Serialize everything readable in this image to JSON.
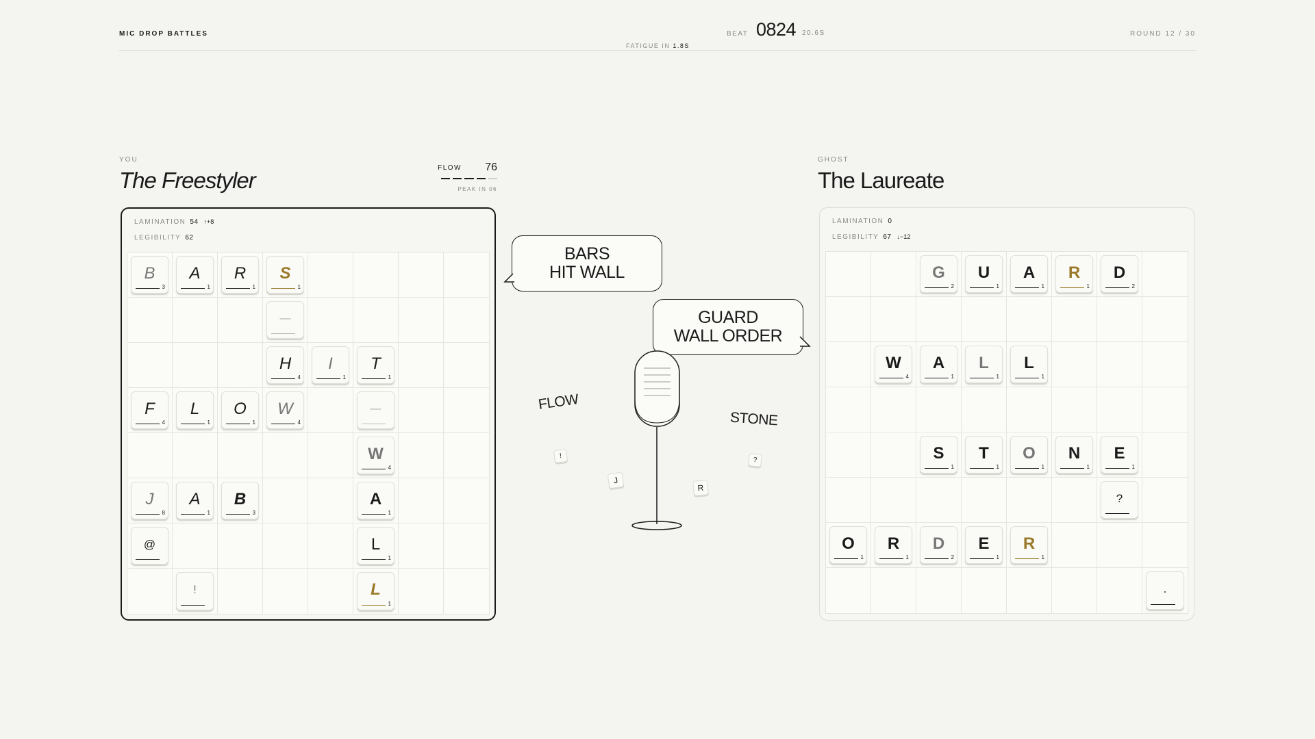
{
  "header": {
    "brand": "MIC DROP BATTLES",
    "beat_label": "BEAT",
    "beat_number": "0824",
    "beat_time": "20.6S",
    "fatigue_label": "FATIGUE IN",
    "fatigue_value": "1.8S",
    "round": "ROUND 12 / 30"
  },
  "player": {
    "side_label": "YOU",
    "name": "The Freestyler",
    "flow_label": "FLOW",
    "flow_value": "76",
    "flow_level": 0.8,
    "peak_label": "PEAK IN 06",
    "lamination_label": "LAMINATION",
    "lamination_value": "54",
    "lamination_delta": "↑+8",
    "legibility_label": "LEGIBILITY",
    "legibility_value": "62",
    "tiles": [
      {
        "r": 0,
        "c": 0,
        "ch": "B",
        "pt": "3",
        "s": "it gray"
      },
      {
        "r": 0,
        "c": 1,
        "ch": "A",
        "pt": "1",
        "s": "it"
      },
      {
        "r": 0,
        "c": 2,
        "ch": "R",
        "pt": "1",
        "s": "it"
      },
      {
        "r": 0,
        "c": 3,
        "ch": "S",
        "pt": "1",
        "s": "it gold bd"
      },
      {
        "r": 1,
        "c": 3,
        "ch": "—",
        "pt": "",
        "s": "dim"
      },
      {
        "r": 2,
        "c": 3,
        "ch": "H",
        "pt": "4",
        "s": "it"
      },
      {
        "r": 2,
        "c": 4,
        "ch": "I",
        "pt": "1",
        "s": "it gray"
      },
      {
        "r": 2,
        "c": 5,
        "ch": "T",
        "pt": "1",
        "s": "it"
      },
      {
        "r": 3,
        "c": 0,
        "ch": "F",
        "pt": "4",
        "s": "it"
      },
      {
        "r": 3,
        "c": 1,
        "ch": "L",
        "pt": "1",
        "s": "it"
      },
      {
        "r": 3,
        "c": 2,
        "ch": "O",
        "pt": "1",
        "s": "it"
      },
      {
        "r": 3,
        "c": 3,
        "ch": "W",
        "pt": "4",
        "s": "it gray"
      },
      {
        "r": 3,
        "c": 5,
        "ch": "—",
        "pt": "",
        "s": "dim"
      },
      {
        "r": 4,
        "c": 5,
        "ch": "W",
        "pt": "4",
        "s": "bd gray"
      },
      {
        "r": 5,
        "c": 0,
        "ch": "J",
        "pt": "8",
        "s": "it gray"
      },
      {
        "r": 5,
        "c": 1,
        "ch": "A",
        "pt": "1",
        "s": "it"
      },
      {
        "r": 5,
        "c": 2,
        "ch": "B",
        "pt": "3",
        "s": "it bd"
      },
      {
        "r": 5,
        "c": 5,
        "ch": "A",
        "pt": "1",
        "s": "bd"
      },
      {
        "r": 6,
        "c": 0,
        "ch": "@",
        "pt": "",
        "s": "sm"
      },
      {
        "r": 6,
        "c": 5,
        "ch": "L",
        "pt": "1",
        "s": ""
      },
      {
        "r": 7,
        "c": 1,
        "ch": "!",
        "pt": "",
        "s": "sm gray"
      },
      {
        "r": 7,
        "c": 5,
        "ch": "L",
        "pt": "1",
        "s": "it gold bd"
      }
    ]
  },
  "ghost": {
    "side_label": "GHOST",
    "name": "The Laureate",
    "lamination_label": "LAMINATION",
    "lamination_value": "0",
    "legibility_label": "LEGIBILITY",
    "legibility_value": "67",
    "legibility_delta": "↓−12",
    "tiles": [
      {
        "r": 0,
        "c": 2,
        "ch": "G",
        "pt": "2",
        "s": "bd gray"
      },
      {
        "r": 0,
        "c": 3,
        "ch": "U",
        "pt": "1",
        "s": "bd"
      },
      {
        "r": 0,
        "c": 4,
        "ch": "A",
        "pt": "1",
        "s": "bd"
      },
      {
        "r": 0,
        "c": 5,
        "ch": "R",
        "pt": "1",
        "s": "bd gold"
      },
      {
        "r": 0,
        "c": 6,
        "ch": "D",
        "pt": "2",
        "s": "bd"
      },
      {
        "r": 2,
        "c": 1,
        "ch": "W",
        "pt": "4",
        "s": "bd"
      },
      {
        "r": 2,
        "c": 2,
        "ch": "A",
        "pt": "1",
        "s": "bd"
      },
      {
        "r": 2,
        "c": 3,
        "ch": "L",
        "pt": "1",
        "s": "bd gray"
      },
      {
        "r": 2,
        "c": 4,
        "ch": "L",
        "pt": "1",
        "s": "bd"
      },
      {
        "r": 4,
        "c": 2,
        "ch": "S",
        "pt": "1",
        "s": "bd"
      },
      {
        "r": 4,
        "c": 3,
        "ch": "T",
        "pt": "1",
        "s": "bd"
      },
      {
        "r": 4,
        "c": 4,
        "ch": "O",
        "pt": "1",
        "s": "bd gray"
      },
      {
        "r": 4,
        "c": 5,
        "ch": "N",
        "pt": "1",
        "s": "bd"
      },
      {
        "r": 4,
        "c": 6,
        "ch": "E",
        "pt": "1",
        "s": "bd"
      },
      {
        "r": 5,
        "c": 6,
        "ch": "?",
        "pt": "",
        "s": "sm"
      },
      {
        "r": 6,
        "c": 0,
        "ch": "O",
        "pt": "1",
        "s": "bd"
      },
      {
        "r": 6,
        "c": 1,
        "ch": "R",
        "pt": "1",
        "s": "bd"
      },
      {
        "r": 6,
        "c": 2,
        "ch": "D",
        "pt": "2",
        "s": "bd gray"
      },
      {
        "r": 6,
        "c": 3,
        "ch": "E",
        "pt": "1",
        "s": "bd"
      },
      {
        "r": 6,
        "c": 4,
        "ch": "R",
        "pt": "1",
        "s": "bd gold"
      },
      {
        "r": 7,
        "c": 7,
        "ch": ".",
        "pt": "",
        "s": "sm"
      }
    ]
  },
  "stage": {
    "player_bubble": [
      "BARS",
      "HIT WALL"
    ],
    "ghost_bubble": [
      "GUARD",
      "WALL ORDER"
    ],
    "word_left": "FLOW",
    "word_right": "STONE",
    "mini_tiles": [
      "!",
      "J",
      "R",
      "?"
    ]
  },
  "colors": {
    "accent_gold": "#9a7a2a",
    "ink": "#1a1a1a",
    "background": "#f4f4f0"
  }
}
